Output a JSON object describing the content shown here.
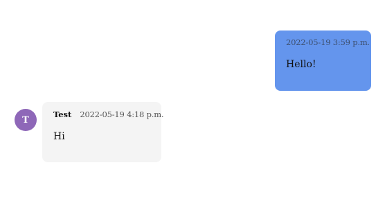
{
  "messages": {
    "outgoing": [
      {
        "timestamp": "2022-05-19 3:59 p.m.",
        "text": "Hello!",
        "bubble_color": "#6495ed"
      }
    ],
    "incoming": [
      {
        "avatar_letter": "T",
        "avatar_color": "#8e67b8",
        "sender": "Test",
        "timestamp": "2022-05-19 4:18 p.m.",
        "text": "Hi",
        "bubble_color": "#f4f4f4"
      }
    ]
  }
}
